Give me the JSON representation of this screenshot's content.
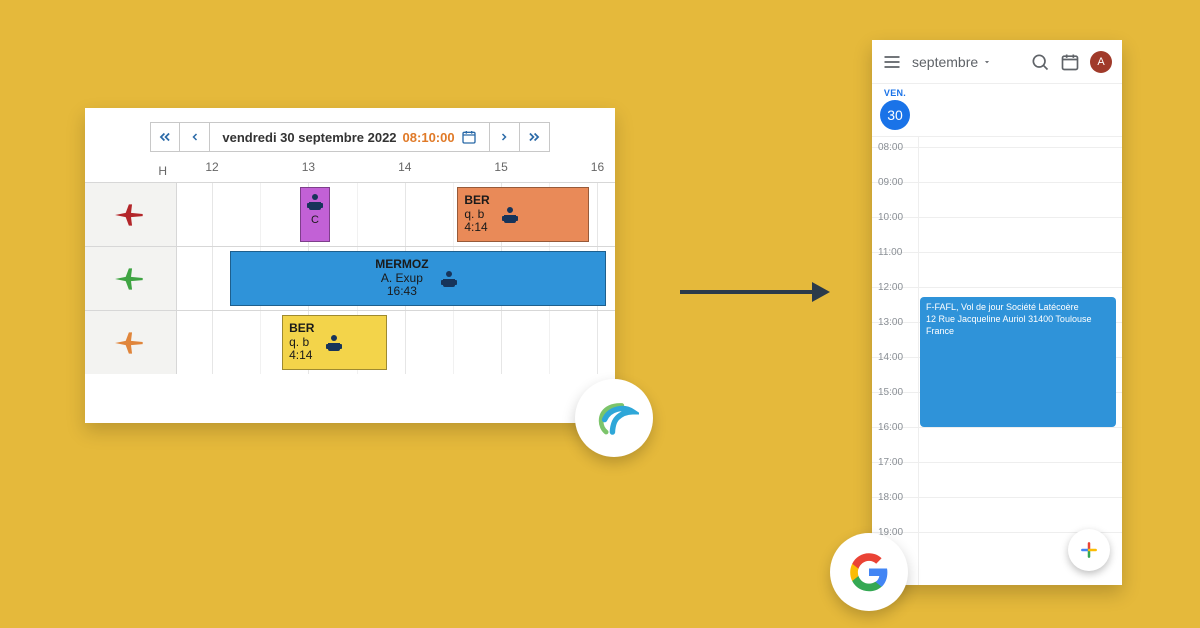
{
  "schedule": {
    "nav": {
      "date_text": "vendredi 30 septembre 2022",
      "time_text": "08:10:00"
    },
    "hour_col_label": "H",
    "hour_ticks": [
      "12",
      "13",
      "14",
      "15",
      "16"
    ],
    "lanes": [
      {
        "plane_color": "#b3262a"
      },
      {
        "plane_color": "#3fa443"
      },
      {
        "plane_color": "#e0853b"
      }
    ],
    "blocks": {
      "r1_purple": {
        "caption": "C"
      },
      "r1_orange": {
        "line1": "BER",
        "line2": "q. b",
        "line3": "4:14"
      },
      "r2_blue": {
        "line1": "MERMOZ",
        "line2": "A. Exup",
        "line3": "16:43"
      },
      "r3_yellow": {
        "line1": "BER",
        "line2": "q. b",
        "line3": "4:14"
      }
    }
  },
  "gcal": {
    "title": "septembre",
    "avatar_letter": "A",
    "weekday": "VEN.",
    "day_number": "30",
    "hours": [
      "08:00",
      "09:00",
      "10:00",
      "11:00",
      "12:00",
      "13:00",
      "14:00",
      "15:00",
      "16:00",
      "17:00",
      "18:00",
      "19:00"
    ],
    "event": {
      "line1": "F-FAFL, Vol de jour Société Latécoère",
      "line2": "12 Rue Jacqueline Auriol 31400 Toulouse France"
    }
  }
}
